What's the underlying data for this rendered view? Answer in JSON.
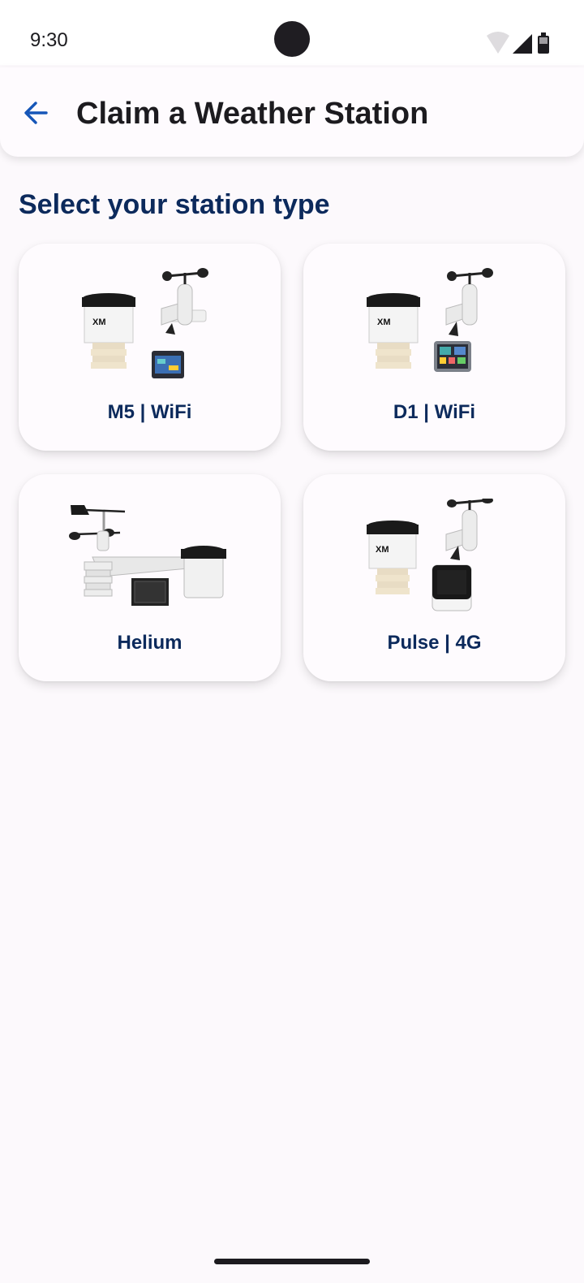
{
  "status_bar": {
    "time": "9:30",
    "icons": [
      "wifi-icon",
      "signal-icon",
      "battery-icon"
    ]
  },
  "app_bar": {
    "back_icon": "arrow-back-icon",
    "title": "Claim a Weather Station"
  },
  "main": {
    "heading": "Select your station type",
    "stations": [
      {
        "label": "M5 | WiFi",
        "image": "m5-station-image"
      },
      {
        "label": "D1 | WiFi",
        "image": "d1-station-image"
      },
      {
        "label": "Helium",
        "image": "helium-station-image"
      },
      {
        "label": "Pulse | 4G",
        "image": "pulse-station-image"
      }
    ]
  },
  "colors": {
    "accent": "#1656b8",
    "heading": "#0c2a5c",
    "background": "#fcf9fc"
  }
}
